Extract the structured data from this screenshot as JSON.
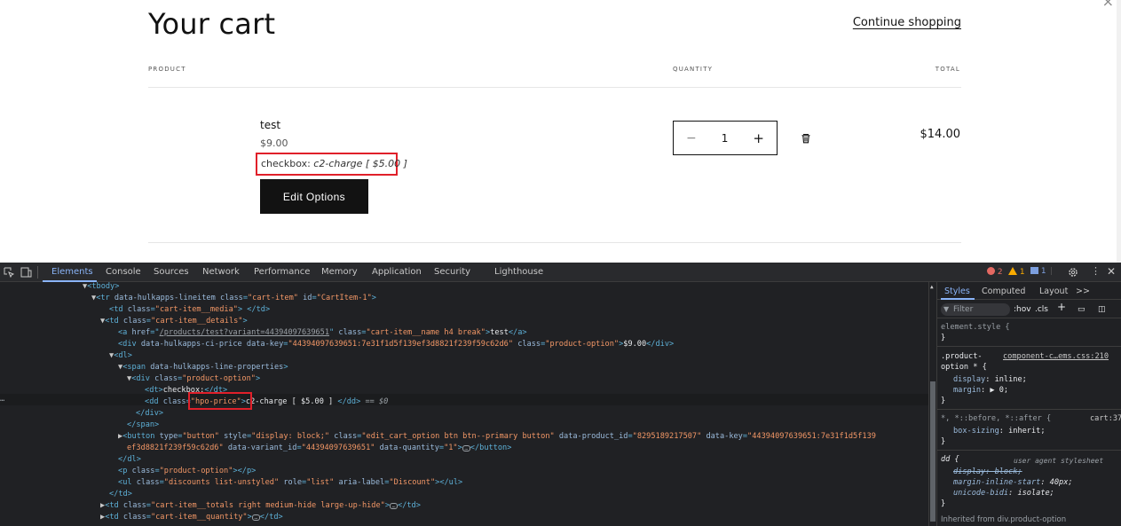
{
  "page": {
    "title": "Your cart",
    "continue_shopping": "Continue shopping",
    "columns": {
      "product": "PRODUCT",
      "quantity": "QUANTITY",
      "total": "TOTAL"
    },
    "item": {
      "name": "test",
      "price": "$9.00",
      "property_label": "checkbox:",
      "property_value": "c2-charge [ $5.00 ]",
      "edit_button": "Edit Options",
      "quantity": "1",
      "minus": "−",
      "plus": "+",
      "total": "$14.00"
    }
  },
  "devtools": {
    "tabs": [
      "Elements",
      "Console",
      "Sources",
      "Network",
      "Performance",
      "Memory",
      "Application",
      "Security",
      "Lighthouse"
    ],
    "active_tab": "Elements",
    "errors": "2",
    "warnings": "1",
    "infos": "1",
    "dom_lines": {
      "l1": "<tbody>",
      "l2_tag": "tr",
      "l2_attr1": "data-hulkapps-lineitem",
      "l2_attr2": "class",
      "l2_val2": "\"cart-item\"",
      "l2_attr3": "id",
      "l2_val3": "\"CartItem-1\"",
      "l3_tag": "td",
      "l3_attr": "class",
      "l3_val": "\"cart-item__media\"",
      "l4_tag": "td",
      "l4_attr": "class",
      "l4_val": "\"cart-item__details\"",
      "l5_attr1": "href",
      "l5_val1": "/products/test?variant=44394097639651",
      "l5_attr2": "class",
      "l5_val2": "\"cart-item__name h4 break\"",
      "l5_text": "test",
      "l6_attr1": "data-hulkapps-ci-price",
      "l6_attr2": "data-key",
      "l6_val2": "\"44394097639651:7e31f1d5f139ef3d8821f239f59c62d6\"",
      "l6_attr3": "class",
      "l6_val3": "\"product-option\"",
      "l6_text": "$9.00",
      "l7_tag": "dl",
      "l8_tag": "span",
      "l8_attr": "data-hulkapps-line-properties",
      "l9_tag": "div",
      "l9_attr": "class",
      "l9_val": "\"product-option\"",
      "l10_tag": "dt",
      "l10_text": "checkbox:",
      "l11_tag": "dd",
      "l11_attr": "class",
      "l11_val": "\"hpo-price\"",
      "l11_text": "c2-charge [ $5.00 ]",
      "l11_eq": "== $0",
      "l12": "</div>",
      "l13": "</span>",
      "l14_attr1": "type",
      "l14_val1": "\"button\"",
      "l14_attr2": "style",
      "l14_val2": "\"display: block;\"",
      "l14_attr3": "class",
      "l14_val3": "\"edit_cart_option btn btn--primary button\"",
      "l14_attr4": "data-product_id",
      "l14_val4": "\"8295189217507\"",
      "l14_attr5": "data-key",
      "l14_val5": "\"44394097639651:7e31f1d5f139",
      "l15_val5b": "ef3d8821f239f59c62d6\"",
      "l15_attr6": "data-variant_id",
      "l15_val6": "\"44394097639651\"",
      "l15_attr7": "data-quantity",
      "l15_val7": "\"1\"",
      "l16": "</dl>",
      "l17_tag": "p",
      "l17_attr": "class",
      "l17_val": "\"product-option\"",
      "l18_tag": "ul",
      "l18_attr1": "class",
      "l18_val1": "\"discounts list-unstyled\"",
      "l18_attr2": "role",
      "l18_val2": "\"list\"",
      "l18_attr3": "aria-label",
      "l18_val3": "\"Discount\"",
      "l19": "</td>",
      "l20_attr": "class",
      "l20_val": "\"cart-item__totals right medium-hide large-up-hide\"",
      "l21_attr": "class",
      "l21_val": "\"cart-item__quantity\""
    },
    "styles": {
      "tabs": [
        "Styles",
        "Computed",
        "Layout"
      ],
      "filter_placeholder": "Filter",
      "hov": ":hov",
      "cls": ".cls",
      "element_style": "element.style {",
      "close_brace": "}",
      "rule1_selector_a": ".product-",
      "rule1_selector_b": "option * {",
      "rule1_source": "component-c…ems.css:210",
      "rule1_p1": "display",
      "rule1_v1": "inline;",
      "rule1_p2": "margin",
      "rule1_v2": "▶ 0;",
      "rule2_selector": "*, *::before, *::after {",
      "rule2_source": "cart:371",
      "rule2_p1": "box-sizing",
      "rule2_v1": "inherit;",
      "rule3_selector": "dd {",
      "rule3_source": "user agent stylesheet",
      "rule3_p1": "display: block;",
      "rule3_p2": "margin-inline-start",
      "rule3_v2": "40px;",
      "rule3_p3": "unicode-bidi",
      "rule3_v3": "isolate;",
      "inherited": "Inherited from div.product-option"
    }
  }
}
